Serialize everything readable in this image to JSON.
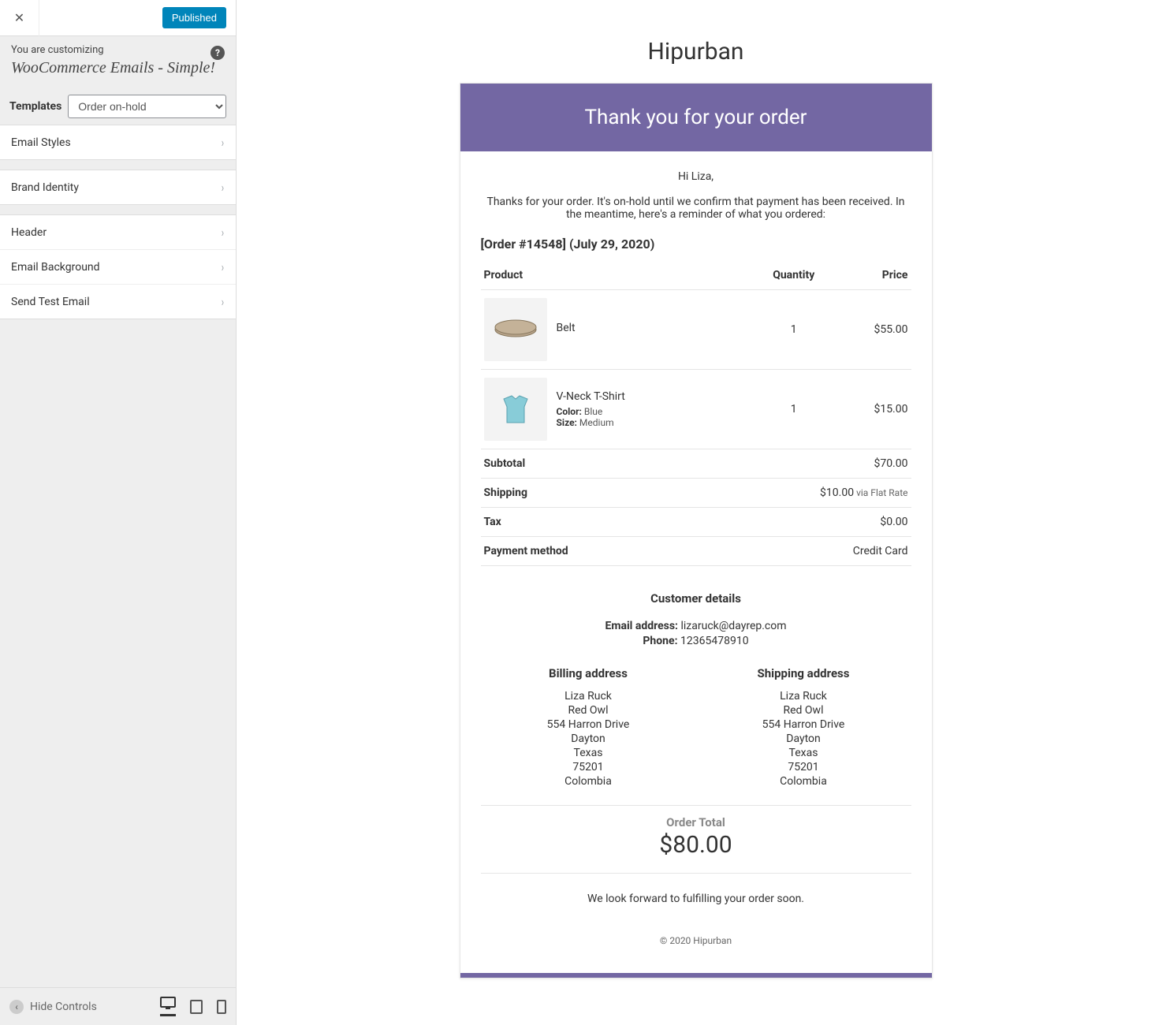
{
  "sidebar": {
    "published_label": "Published",
    "customizing_label": "You are customizing",
    "customizing_title": "WooCommerce Emails - Simple!",
    "templates_label": "Templates",
    "templates_selected": "Order on-hold",
    "items": [
      {
        "label": "Email Styles"
      },
      {
        "label": "Brand Identity"
      },
      {
        "label": "Header"
      },
      {
        "label": "Email Background"
      },
      {
        "label": "Send Test Email"
      }
    ],
    "hide_controls": "Hide Controls"
  },
  "email": {
    "brand": "Hipurban",
    "header": "Thank you for your order",
    "greeting": "Hi Liza,",
    "intro": "Thanks for your order. It's on-hold until we confirm that payment has been received. In the meantime, here's a reminder of what you ordered:",
    "order_title": "[Order #14548] (July 29, 2020)",
    "table_headers": {
      "product": "Product",
      "quantity": "Quantity",
      "price": "Price"
    },
    "items": [
      {
        "name": "Belt",
        "qty": "1",
        "price": "$55.00",
        "attrs": []
      },
      {
        "name": "V-Neck T-Shirt",
        "qty": "1",
        "price": "$15.00",
        "attrs": [
          {
            "label": "Color:",
            "value": "Blue"
          },
          {
            "label": "Size:",
            "value": "Medium"
          }
        ]
      }
    ],
    "totals": [
      {
        "label": "Subtotal",
        "value": "$70.00",
        "note": ""
      },
      {
        "label": "Shipping",
        "value": "$10.00",
        "note": " via Flat Rate"
      },
      {
        "label": "Tax",
        "value": "$0.00",
        "note": ""
      },
      {
        "label": "Payment method",
        "value": "Credit Card",
        "note": ""
      }
    ],
    "customer_details_label": "Customer details",
    "email_label": "Email address:",
    "email_value": "lizaruck@dayrep.com",
    "phone_label": "Phone:",
    "phone_value": "12365478910",
    "billing_heading": "Billing address",
    "shipping_heading": "Shipping address",
    "billing": [
      "Liza Ruck",
      "Red Owl",
      "554 Harron Drive",
      "Dayton",
      "Texas",
      "75201",
      "Colombia"
    ],
    "shipping": [
      "Liza Ruck",
      "Red Owl",
      "554 Harron Drive",
      "Dayton",
      "Texas",
      "75201",
      "Colombia"
    ],
    "order_total_label": "Order Total",
    "order_total_value": "$80.00",
    "closing": "We look forward to fulfilling your order soon.",
    "footer": "© 2020 Hipurban"
  }
}
